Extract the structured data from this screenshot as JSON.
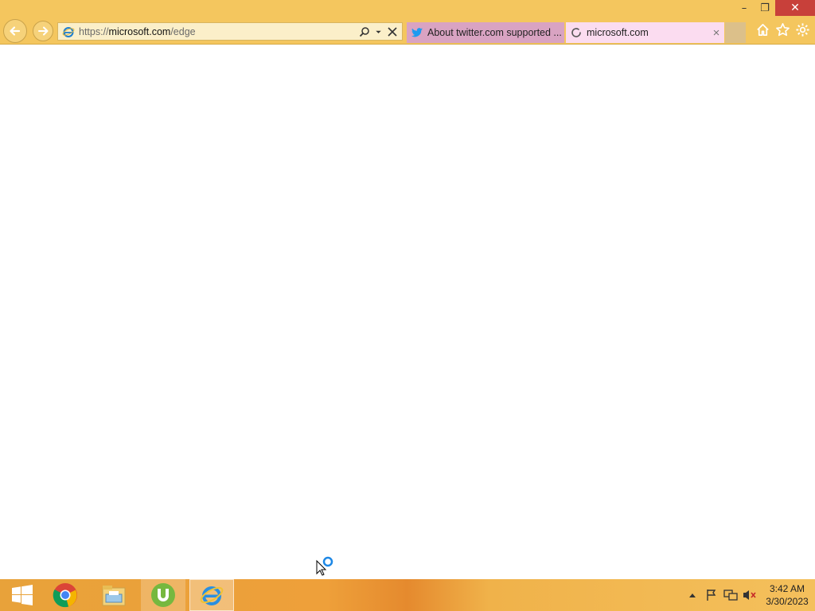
{
  "browser": {
    "address_bar": {
      "url_proto": "https://",
      "url_host": "microsoft.com",
      "url_path": "/edge"
    },
    "tabs": [
      {
        "label": "About twitter.com supported ...",
        "icon": "twitter-bird-icon",
        "state": "inactive"
      },
      {
        "label": "microsoft.com",
        "icon": "loading-spinner-icon",
        "state": "active",
        "close": "×"
      }
    ],
    "window_controls": {
      "minimize": "–",
      "restore": "❐",
      "close": "✕"
    }
  },
  "taskbar": {
    "apps": [
      {
        "name": "start-button",
        "icon": "windows-logo-icon"
      },
      {
        "name": "chrome",
        "icon": "chrome-icon"
      },
      {
        "name": "file-explorer",
        "icon": "file-explorer-icon"
      },
      {
        "name": "utorrent",
        "icon": "utorrent-icon"
      },
      {
        "name": "internet-explorer",
        "icon": "internet-explorer-icon"
      }
    ],
    "tray": {
      "icons": [
        "show-hidden-icons-icon",
        "action-center-flag-icon",
        "network-icon",
        "volume-muted-icon"
      ],
      "time": "3:42 AM",
      "date": "3/30/2023"
    }
  },
  "colors": {
    "chrome_bg": "#f4c65e",
    "close_button": "#c8403a",
    "active_tab": "#fbdcf0",
    "inactive_tab": "#d9a3c2"
  }
}
